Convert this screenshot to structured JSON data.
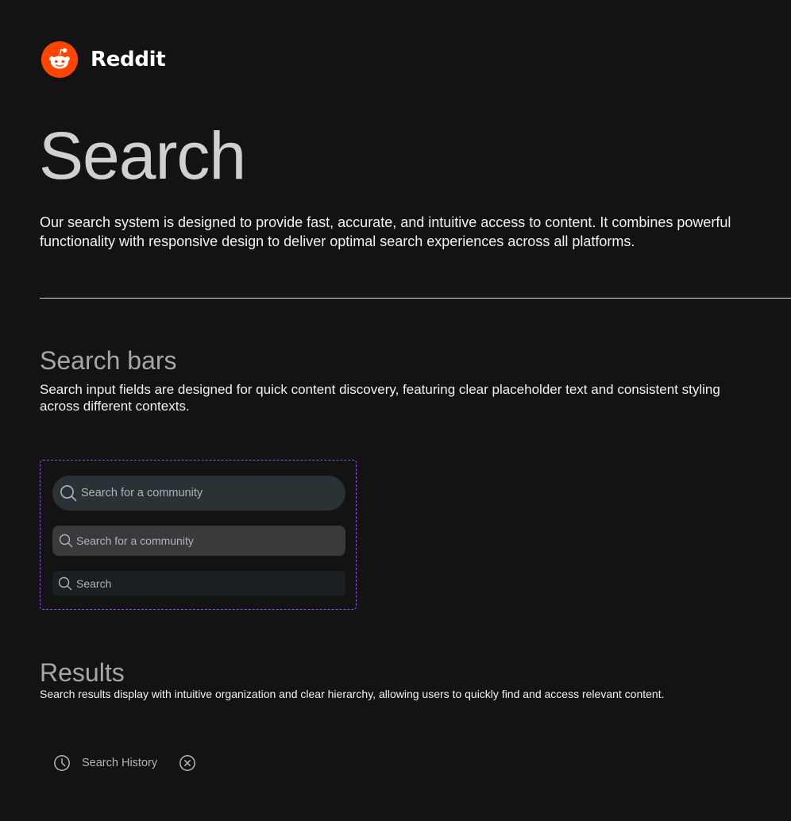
{
  "brand": {
    "name": "Reddit",
    "logo_icon": "reddit-snoo-icon",
    "accent": "#ff4500"
  },
  "hero": {
    "title": "Search",
    "description": "Our search system is designed to provide fast, accurate, and intuitive access to content. It combines powerful functionality with responsive design to deliver optimal search experiences across all platforms."
  },
  "search_bars": {
    "title": "Search bars",
    "description": "Search input fields are designed for quick content discovery, featuring clear placeholder text and consistent styling across different contexts.",
    "frame_border_color": "#8a4ff0",
    "variants": [
      {
        "placeholder": "Search for a community",
        "icon": "search-icon",
        "background": "#2a3236"
      },
      {
        "placeholder": "Search for a community",
        "icon": "search-icon",
        "background": "#3a3a3c"
      },
      {
        "placeholder": "Search",
        "icon": "search-icon",
        "background": "#1c1f22"
      }
    ]
  },
  "results": {
    "title": "Results",
    "description": "Search results display with intuitive organization and clear hierarchy, allowing users to quickly find and access relevant content.",
    "history_item": {
      "label": "Search History",
      "leading_icon": "clock-icon",
      "trailing_icon": "close-circle-icon"
    }
  }
}
